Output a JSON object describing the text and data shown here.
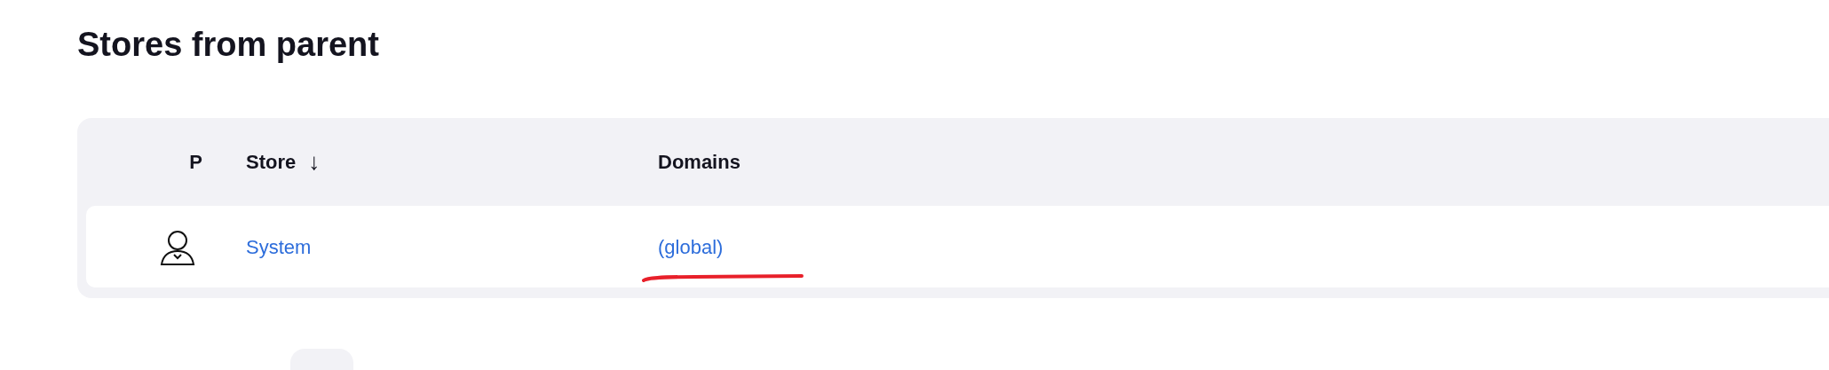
{
  "heading": "Stores from parent",
  "table": {
    "columns": [
      {
        "label": "P"
      },
      {
        "label": "Store",
        "sort_indicator": "↓"
      },
      {
        "label": "Domains"
      }
    ],
    "rows": [
      {
        "store": "System",
        "domains": "(global)"
      }
    ]
  }
}
